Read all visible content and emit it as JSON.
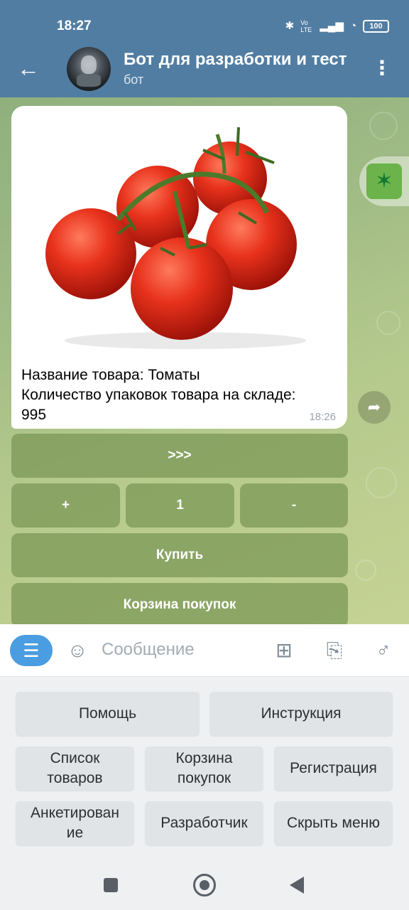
{
  "status_bar": {
    "time": "18:27",
    "bluetooth_icon": "bluetooth-icon",
    "volte": "Vo LTE",
    "signal_icon": "signal-icon",
    "wifi_icon": "wifi-icon",
    "battery": "100"
  },
  "header": {
    "title": "Бот для разработки и тест",
    "subtitle": "бот"
  },
  "message": {
    "image": "tomato-photo",
    "caption_line1": "Название товара: Томаты",
    "caption_line2": "Количество упаковок товара на складе:",
    "caption_line3": "995",
    "time": "18:26"
  },
  "inline_keyboard": {
    "next": ">>>",
    "plus": "+",
    "quantity": "1",
    "minus": "-",
    "buy": "Купить",
    "cart": "Корзина покупок"
  },
  "input": {
    "placeholder": "Сообщение"
  },
  "reply_keyboard": {
    "help": "Помощь",
    "instruction": "Инструкция",
    "products_1": "Список",
    "products_2": "товаров",
    "cart_1": "Корзина",
    "cart_2": "покупок",
    "registration": "Регистрация",
    "survey_1": "Анкетирован",
    "survey_2": "ие",
    "developer": "Разработчик",
    "hide_menu": "Скрыть меню"
  },
  "colors": {
    "header": "#517da2",
    "accent": "#4a9de0",
    "inline_button": "#7f9a5a"
  }
}
